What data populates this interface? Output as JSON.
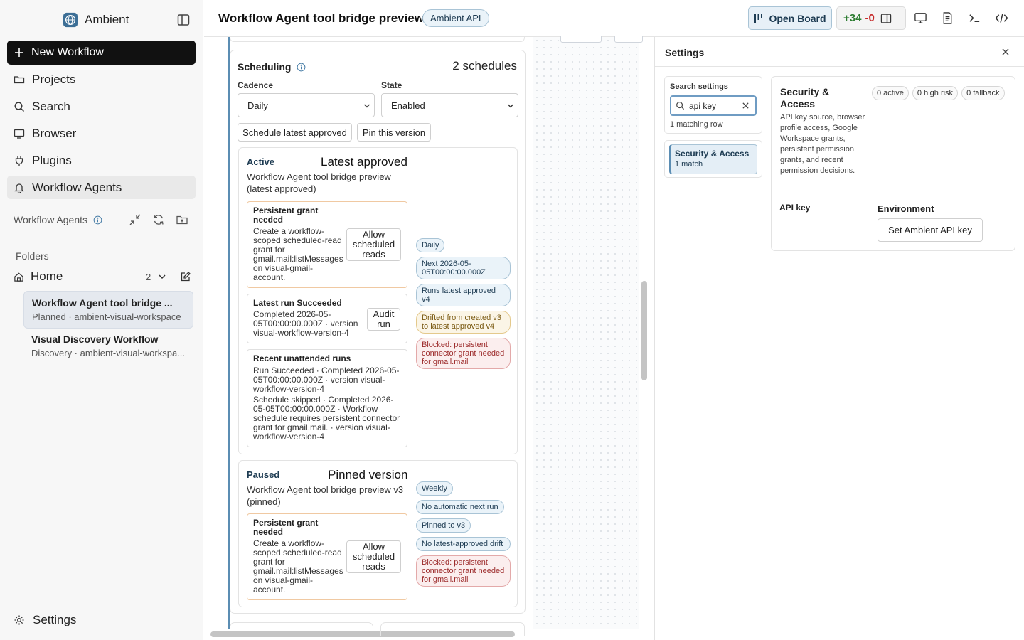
{
  "sidebar": {
    "brand": "Ambient",
    "new_workflow": "New Workflow",
    "nav": [
      {
        "label": "Projects",
        "icon": "folder-icon"
      },
      {
        "label": "Search",
        "icon": "search-icon"
      },
      {
        "label": "Browser",
        "icon": "monitor-icon"
      },
      {
        "label": "Plugins",
        "icon": "plug-icon"
      },
      {
        "label": "Workflow Agents",
        "icon": "bell-icon",
        "active": true
      }
    ],
    "section_title": "Workflow Agents",
    "folders_label": "Folders",
    "home": {
      "label": "Home",
      "count": "2"
    },
    "workflows": [
      {
        "title": "Workflow Agent tool bridge ...",
        "subtitle": "Planned · ambient-visual-workspace",
        "selected": true
      },
      {
        "title": "Visual Discovery Workflow",
        "subtitle": "Discovery · ambient-visual-workspa...",
        "selected": false
      }
    ],
    "settings": "Settings"
  },
  "topbar": {
    "title": "Workflow Agent tool bridge preview",
    "badge": "Ambient API",
    "open_board": "Open Board",
    "additions": "+34",
    "deletions": "-0"
  },
  "scheduling": {
    "title": "Scheduling",
    "count": "2 schedules",
    "cadence_label": "Cadence",
    "cadence_value": "Daily",
    "state_label": "State",
    "state_value": "Enabled",
    "btn_schedule_latest": "Schedule latest approved",
    "btn_pin_version": "Pin this version",
    "active": {
      "state": "Active",
      "name": "Latest approved",
      "desc": "Workflow Agent tool bridge preview (latest approved)",
      "grant": {
        "title": "Persistent grant needed",
        "body": "Create a workflow-scoped scheduled-read grant for gmail.mail:listMessages on visual-gmail-account.",
        "button": "Allow scheduled reads"
      },
      "latest_run": {
        "title": "Latest run Succeeded",
        "body": "Completed 2026-05-05T00:00:00.000Z · version visual-workflow-version-4",
        "button": "Audit run"
      },
      "recent": {
        "title": "Recent unattended runs",
        "run1": "Run Succeeded · Completed 2026-05-05T00:00:00.000Z · version visual-workflow-version-4",
        "run2": "Schedule skipped · Completed 2026-05-05T00:00:00.000Z · Workflow schedule requires persistent connector grant for gmail.mail. · version visual-workflow-version-4"
      },
      "pills": {
        "cadence": "Daily",
        "next": "Next 2026-05-05T00:00:00.000Z",
        "runs": "Runs latest approved v4",
        "drift": "Drifted from created v3 to latest approved v4",
        "blocked": "Blocked: persistent connector grant needed for gmail.mail"
      }
    },
    "paused": {
      "state": "Paused",
      "name": "Pinned version",
      "desc": "Workflow Agent tool bridge preview v3 (pinned)",
      "grant": {
        "title": "Persistent grant needed",
        "body": "Create a workflow-scoped scheduled-read grant for gmail.mail:listMessages on visual-gmail-account.",
        "button": "Allow scheduled reads"
      },
      "pills": {
        "cadence": "Weekly",
        "next": "No automatic next run",
        "pinned": "Pinned to v3",
        "drift": "No latest-approved drift",
        "blocked": "Blocked: persistent connector grant needed for gmail.mail"
      }
    }
  },
  "settings_panel": {
    "title": "Settings",
    "search_label": "Search settings",
    "search_value": "api key",
    "match_count": "1 matching row",
    "section_item": {
      "title": "Security & Access",
      "subtitle": "1 match"
    },
    "card": {
      "title": "Security & Access",
      "badges": [
        "0 active",
        "0 high risk",
        "0 fallback"
      ],
      "desc": "API key source, browser profile access, Google Workspace grants, persistent permission grants, and recent permission decisions.",
      "api_key_label": "API key",
      "env_label": "Environment",
      "set_key_button": "Set Ambient API key"
    }
  },
  "colors": {
    "accent": "#5b8db3",
    "primary_button": "#111111",
    "additions": "#2e7d32",
    "deletions": "#c62828",
    "blocked": "#9c2b2b",
    "drift": "#7a5a12"
  }
}
